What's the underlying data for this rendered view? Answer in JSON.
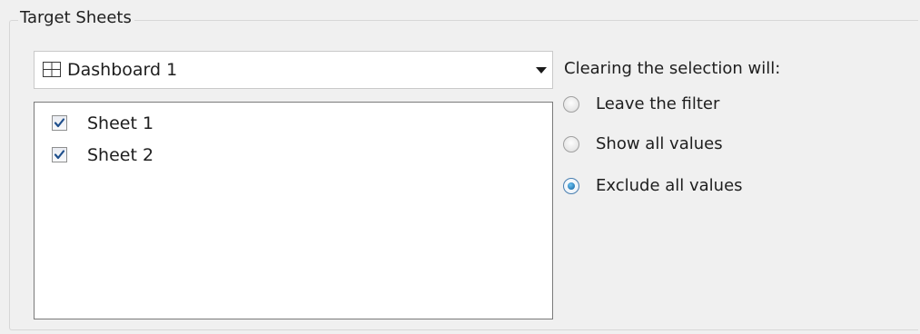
{
  "group": {
    "title": "Target Sheets"
  },
  "dropdown": {
    "icon": "dashboard-icon",
    "selected": "Dashboard 1"
  },
  "sheets": [
    {
      "label": "Sheet 1",
      "checked": true
    },
    {
      "label": "Sheet 2",
      "checked": true
    }
  ],
  "clearing": {
    "title": "Clearing the selection will:",
    "options": [
      {
        "label": "Leave the filter",
        "selected": false
      },
      {
        "label": "Show all values",
        "selected": false
      },
      {
        "label": "Exclude all values",
        "selected": true
      }
    ]
  },
  "colors": {
    "panel_bg": "#f0f0f0",
    "check": "#1f4f8c",
    "radio_accent": "#0e5d9c"
  }
}
